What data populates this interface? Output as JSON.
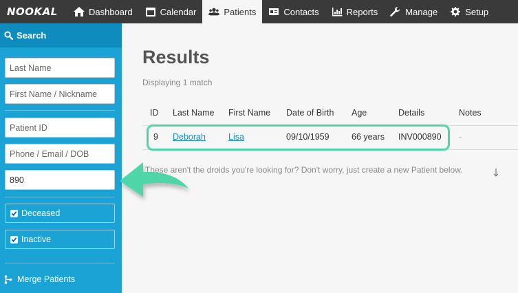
{
  "brand": {
    "logo_text": "NOOKAL"
  },
  "nav": {
    "items": [
      {
        "label": "Dashboard",
        "icon": "home-icon"
      },
      {
        "label": "Calendar",
        "icon": "calendar-icon"
      },
      {
        "label": "Patients",
        "icon": "users-icon",
        "active": true
      },
      {
        "label": "Contacts",
        "icon": "id-card-icon"
      },
      {
        "label": "Reports",
        "icon": "bar-chart-icon"
      },
      {
        "label": "Manage",
        "icon": "wrench-icon"
      },
      {
        "label": "Setup",
        "icon": "gear-icon"
      }
    ]
  },
  "sidebar": {
    "title": "Search",
    "fields": {
      "last_name_placeholder": "Last Name",
      "first_name_placeholder": "First Name / Nickname",
      "patient_id_placeholder": "Patient ID",
      "contact_placeholder": "Phone / Email / DOB",
      "query_value": "890"
    },
    "checkboxes": [
      {
        "label": "Deceased",
        "checked": true
      },
      {
        "label": "Inactive",
        "checked": true
      }
    ],
    "merge_label": "Merge Patients"
  },
  "main": {
    "title": "Results",
    "match_count": "Displaying 1 match",
    "columns": [
      "ID",
      "Last Name",
      "First Name",
      "Date of Birth",
      "Age",
      "Details",
      "Notes"
    ],
    "rows": [
      {
        "id": "9",
        "last_name": "Deborah",
        "first_name": "Lisa",
        "dob": "09/10/1959",
        "age": "66 years",
        "details": "INV000890",
        "notes": "-"
      }
    ],
    "empty_message": "These aren't the droids you're looking for? Don't worry, just create a new Patient below."
  },
  "colors": {
    "sidebar": "#1aa3d4",
    "sidebar_header": "#0e8cbd",
    "nav": "#3a3a3a",
    "highlight": "#4fd6a8",
    "link": "#1a8ecb"
  }
}
